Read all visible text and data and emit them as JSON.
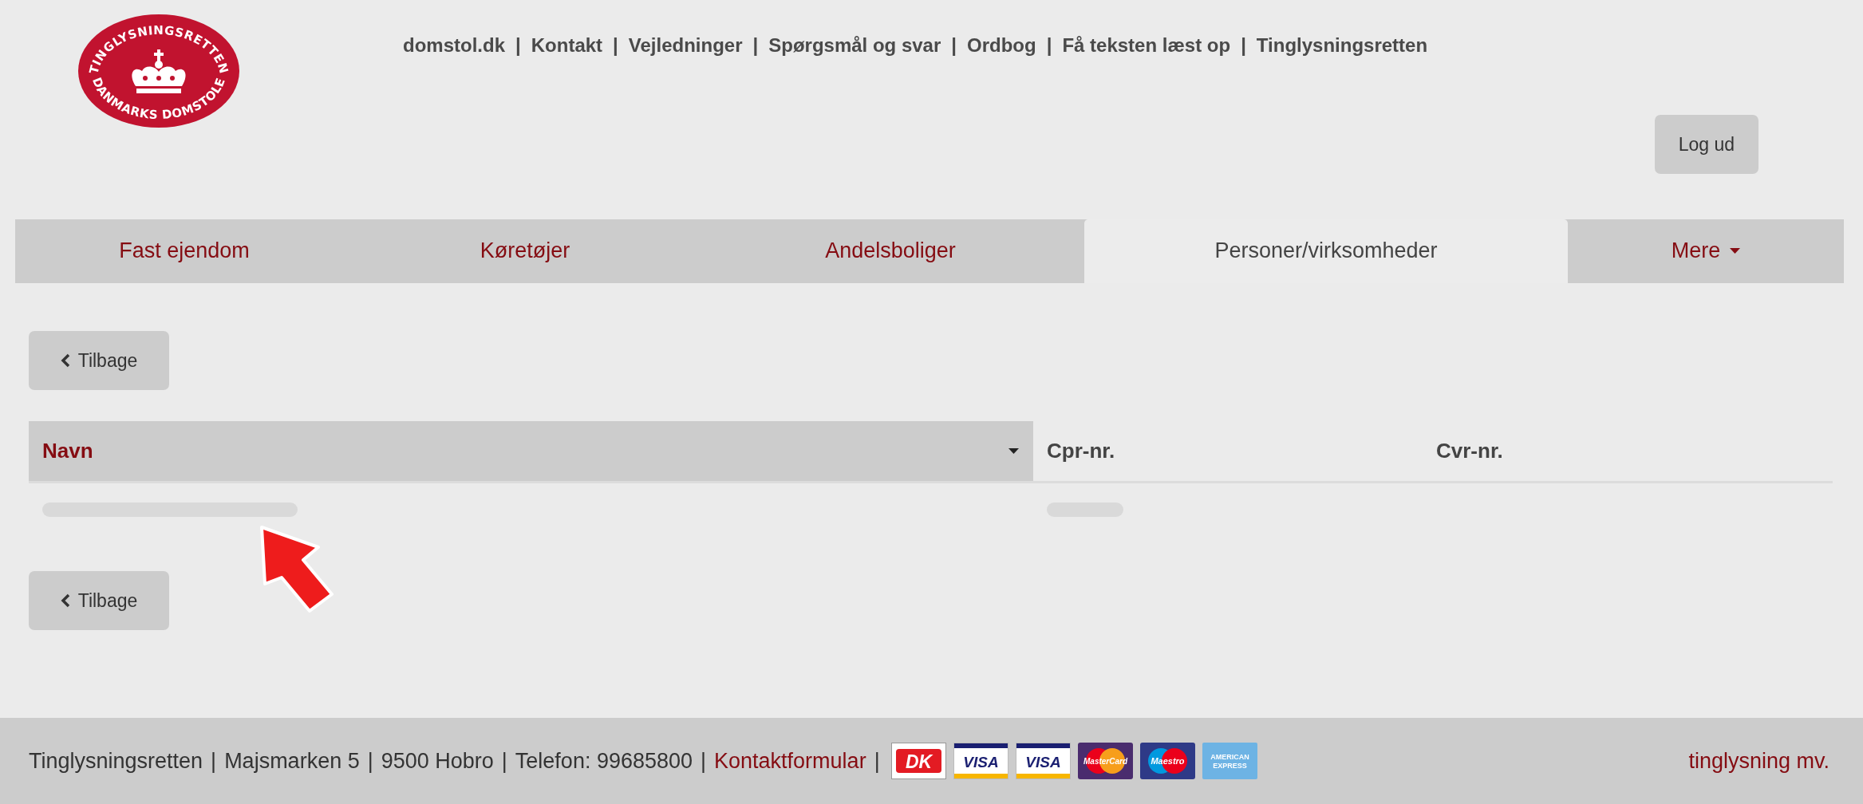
{
  "logo": {
    "top_text": "TINGLYSNINGSRETTEN",
    "bottom_text": "DANMARKS DOMSTOLE"
  },
  "top_links": {
    "separator": "|",
    "items": [
      "domstol.dk",
      "Kontakt",
      "Vejledninger",
      "Spørgsmål og svar",
      "Ordbog",
      "Få teksten læst op",
      "Tinglysningsretten"
    ]
  },
  "logout_button": {
    "label": "Log ud"
  },
  "tabs": [
    {
      "label": "Fast ejendom",
      "selected": false,
      "dropdown": false
    },
    {
      "label": "Køretøjer",
      "selected": false,
      "dropdown": false
    },
    {
      "label": "Andelsboliger",
      "selected": false,
      "dropdown": false
    },
    {
      "label": "Personer/virksomheder",
      "selected": true,
      "dropdown": false
    },
    {
      "label": "Mere",
      "selected": false,
      "dropdown": true
    }
  ],
  "top_back_button": {
    "label": "Tilbage"
  },
  "table": {
    "columns": [
      {
        "label": "Navn",
        "sorted": true
      },
      {
        "label": "Cpr-nr.",
        "sorted": false
      },
      {
        "label": "Cvr-nr.",
        "sorted": false
      }
    ],
    "rows": [
      {
        "cells": [
          {
            "kind": "redacted"
          },
          {
            "kind": "redacted"
          },
          {
            "kind": "blank"
          }
        ]
      }
    ]
  },
  "bottom_back_button": {
    "label": "Tilbage"
  },
  "footer": {
    "separator": "|",
    "items": [
      {
        "kind": "text",
        "text": "Tinglysningsretten"
      },
      {
        "kind": "text",
        "text": "Majsmarken 5"
      },
      {
        "kind": "text",
        "text": "9500 Hobro"
      },
      {
        "kind": "text",
        "text": "Telefon: 99685800"
      },
      {
        "kind": "link",
        "text": "Kontaktformular"
      }
    ],
    "cards": [
      {
        "kind": "dk",
        "label": "DK"
      },
      {
        "kind": "visa",
        "label": "VISA"
      },
      {
        "kind": "visa",
        "label": "VISA"
      },
      {
        "kind": "mastercard",
        "label": "MasterCard"
      },
      {
        "kind": "maestro",
        "label": "Maestro"
      },
      {
        "kind": "amex",
        "label": "AMERICAN EXPRESS"
      }
    ],
    "right_link": "tinglysning mv."
  }
}
